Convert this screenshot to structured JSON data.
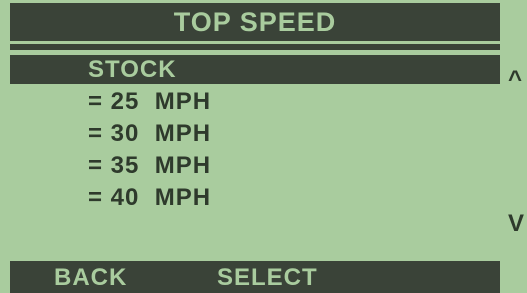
{
  "header": {
    "title": "TOP SPEED"
  },
  "menu": {
    "selected": "STOCK",
    "options": [
      "= 25  MPH",
      "= 30  MPH",
      "= 35  MPH",
      "= 40  MPH"
    ]
  },
  "scroll": {
    "up": "^",
    "down": "V"
  },
  "footer": {
    "back_label": "BACK",
    "select_label": "SELECT"
  },
  "colors": {
    "lcd_background": "#a9cc9e",
    "lcd_dark": "#3a4338"
  }
}
